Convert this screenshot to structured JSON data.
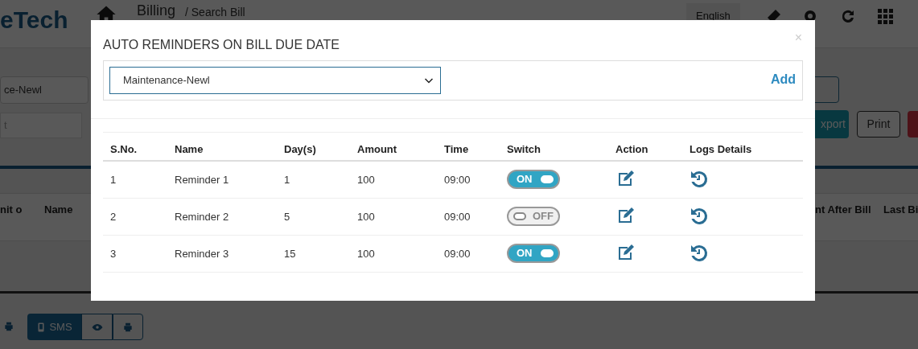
{
  "background": {
    "logo": "eTech",
    "title": "Billing",
    "crumb": "/ Search Bill",
    "language": "English",
    "dropdown": "ce-Newl",
    "search_placeholder": "t",
    "export_button": "xport",
    "print_button": "Print",
    "table_headers": [
      "nit o",
      "Name"
    ],
    "table_headers_right": [
      "nt After Bill",
      "Last Bi"
    ],
    "sms_button": "SMS"
  },
  "modal": {
    "title": "AUTO REMINDERS ON BILL DUE DATE",
    "close": "×",
    "select_value": "Maintenance-Newl",
    "add_link": "Add",
    "columns": [
      "S.No.",
      "Name",
      "Day(s)",
      "Amount",
      "Time",
      "Switch",
      "Action",
      "Logs Details"
    ],
    "rows": [
      {
        "sno": "1",
        "name": "Reminder 1",
        "days": "1",
        "amount": "100",
        "time": "09:00",
        "switch": {
          "on": true,
          "label": "ON"
        }
      },
      {
        "sno": "2",
        "name": "Reminder 2",
        "days": "5",
        "amount": "100",
        "time": "09:00",
        "switch": {
          "on": false,
          "label": "OFF"
        }
      },
      {
        "sno": "3",
        "name": "Reminder 3",
        "days": "15",
        "amount": "100",
        "time": "09:00",
        "switch": {
          "on": true,
          "label": "ON"
        }
      }
    ]
  }
}
